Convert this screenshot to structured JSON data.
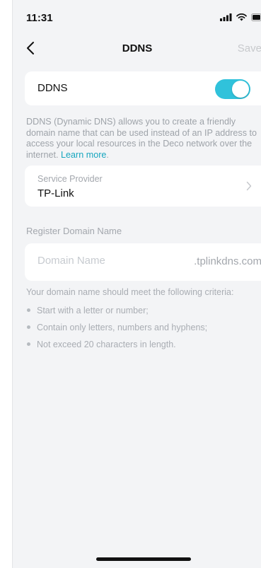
{
  "status_bar": {
    "time": "11:31",
    "icons": [
      "signal-icon",
      "wifi-icon",
      "battery-icon"
    ]
  },
  "nav": {
    "title": "DDNS",
    "save_label": "Save",
    "back_icon": "chevron-left-icon"
  },
  "ddns_toggle": {
    "label": "DDNS",
    "enabled": true,
    "accent": "#30c2db"
  },
  "description": {
    "text": "DDNS (Dynamic DNS) allows you to create a friendly domain name that can be used instead of an IP address to access your local resources in the Deco network over the internet.",
    "link": "Learn more",
    "link_suffix": "."
  },
  "service_provider": {
    "label": "Service Provider",
    "value": "TP-Link"
  },
  "register": {
    "title": "Register Domain Name",
    "placeholder": "Domain Name",
    "value": "",
    "suffix": ".tplinkdns.com"
  },
  "criteria": {
    "title": "Your domain name should meet the following criteria:",
    "items": [
      "Start with a letter or number;",
      "Contain only letters, numbers and hyphens;",
      "Not exceed 20 characters in length."
    ]
  },
  "colors": {
    "background": "#f3f4f6",
    "card": "#ffffff",
    "link": "#17a6bf",
    "muted": "#a3a7ad"
  }
}
